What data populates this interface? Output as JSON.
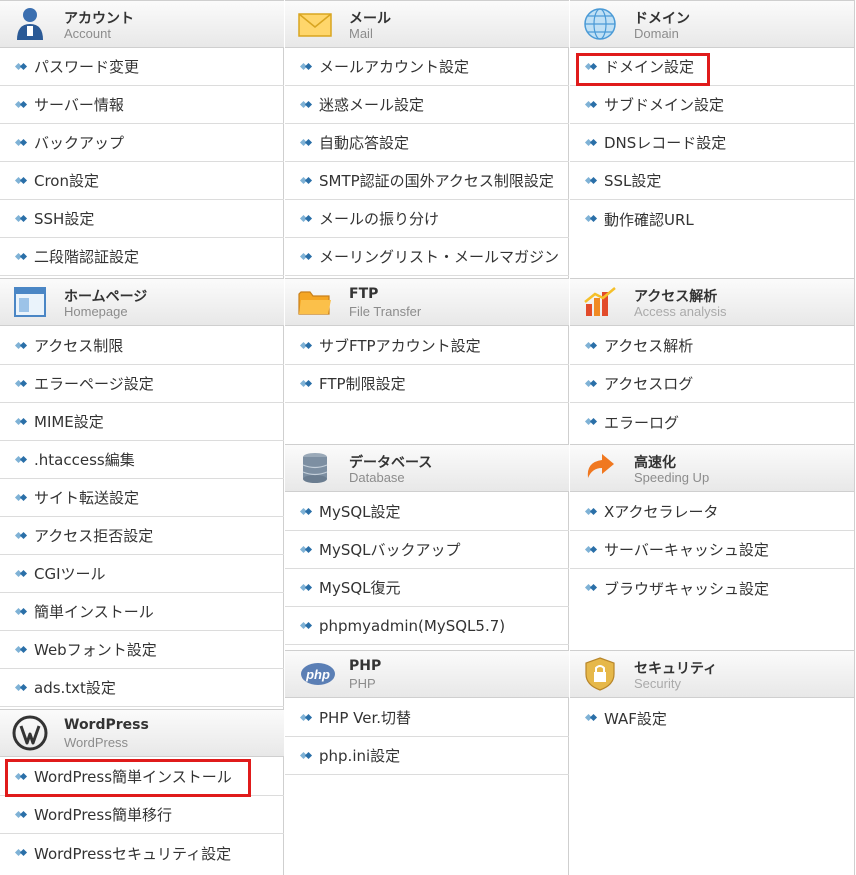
{
  "columns": [
    {
      "sections": [
        {
          "id": "account",
          "title_jp": "アカウント",
          "title_en": "Account",
          "icon": "user-icon",
          "items": [
            "パスワード変更",
            "サーバー情報",
            "バックアップ",
            "Cron設定",
            "SSH設定",
            "二段階認証設定"
          ]
        },
        {
          "id": "homepage",
          "title_jp": "ホームページ",
          "title_en": "Homepage",
          "icon": "browser-window-icon",
          "items": [
            "アクセス制限",
            "エラーページ設定",
            "MIME設定",
            ".htaccess編集",
            "サイト転送設定",
            "アクセス拒否設定",
            "CGIツール",
            "簡単インストール",
            "Webフォント設定",
            "ads.txt設定"
          ]
        },
        {
          "id": "wordpress",
          "title_jp": "WordPress",
          "title_en": "WordPress",
          "icon": "wordpress-logo-icon",
          "items": [
            "WordPress簡単インストール",
            "WordPress簡単移行",
            "WordPressセキュリティ設定"
          ]
        }
      ]
    },
    {
      "sections": [
        {
          "id": "mail",
          "title_jp": "メール",
          "title_en": "Mail",
          "icon": "envelope-icon",
          "items": [
            "メールアカウント設定",
            "迷惑メール設定",
            "自動応答設定",
            "SMTP認証の国外アクセス制限設定",
            "メールの振り分け",
            "メーリングリスト・メールマガジン"
          ]
        },
        {
          "id": "ftp",
          "title_jp": "FTP",
          "title_en": "File Transfer",
          "icon": "folder-icon",
          "items": [
            "サブFTPアカウント設定",
            "FTP制限設定"
          ]
        },
        {
          "id": "database",
          "title_jp": "データベース",
          "title_en": "Database",
          "icon": "database-icon",
          "items": [
            "MySQL設定",
            "MySQLバックアップ",
            "MySQL復元",
            "phpmyadmin(MySQL5.7)"
          ]
        },
        {
          "id": "php",
          "title_jp": "PHP",
          "title_en": "PHP",
          "icon": "php-logo-icon",
          "items": [
            "PHP Ver.切替",
            "php.ini設定"
          ]
        }
      ]
    },
    {
      "sections": [
        {
          "id": "domain",
          "title_jp": "ドメイン",
          "title_en": "Domain",
          "icon": "globe-icon",
          "items": [
            "ドメイン設定",
            "サブドメイン設定",
            "DNSレコード設定",
            "SSL設定",
            "動作確認URL"
          ]
        },
        {
          "id": "access",
          "title_jp": "アクセス解析",
          "title_en": "Access analysis",
          "icon": "bar-chart-icon",
          "items": [
            "アクセス解析",
            "アクセスログ",
            "エラーログ"
          ]
        },
        {
          "id": "speed",
          "title_jp": "高速化",
          "title_en": "Speeding Up",
          "icon": "speed-arrow-icon",
          "items": [
            "Xアクセラレータ",
            "サーバーキャッシュ設定",
            "ブラウザキャッシュ設定"
          ]
        },
        {
          "id": "security",
          "title_jp": "セキュリティ",
          "title_en": "Security",
          "icon": "padlock-shield-icon",
          "items": [
            "WAF設定"
          ]
        }
      ]
    }
  ],
  "highlight_color": "#e01b1b"
}
